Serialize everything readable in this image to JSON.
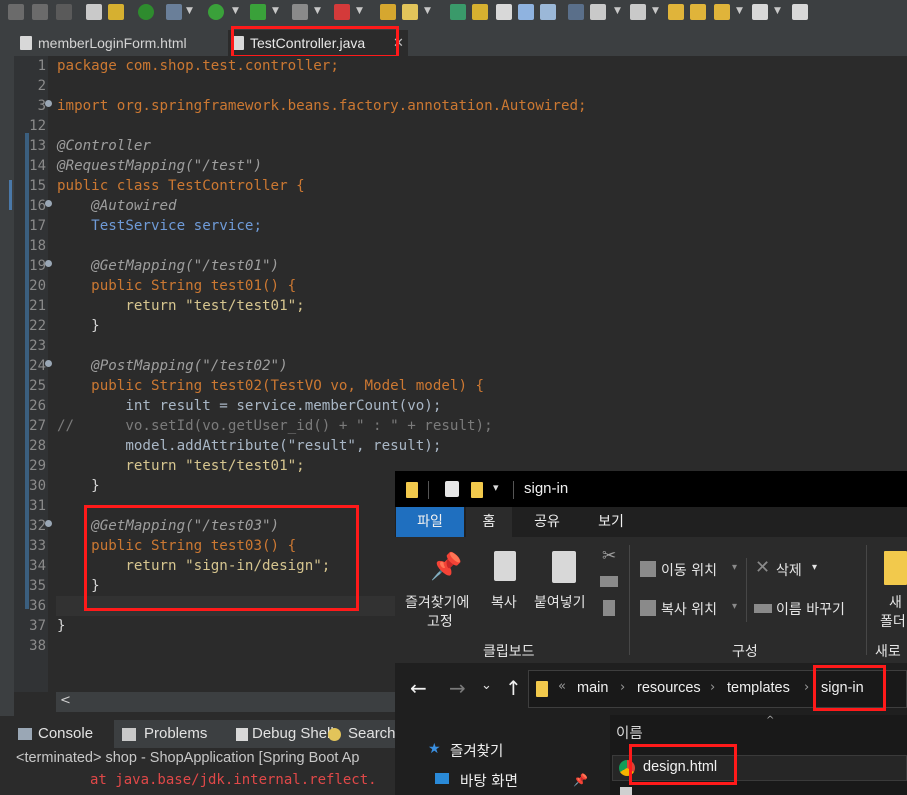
{
  "editor": {
    "tabs": [
      {
        "label": "memberLoginForm.html",
        "active": false
      },
      {
        "label": "TestController.java",
        "active": true
      }
    ],
    "lines": [
      {
        "num": "1",
        "code": "package com.shop.test.controller;"
      },
      {
        "num": "2",
        "code": ""
      },
      {
        "num": "3",
        "code": "import org.springframework.beans.factory.annotation.Autowired;"
      },
      {
        "num": "12",
        "code": ""
      },
      {
        "num": "13",
        "code": "@Controller"
      },
      {
        "num": "14",
        "code": "@RequestMapping(\"/test\")"
      },
      {
        "num": "15",
        "code": "public class TestController {"
      },
      {
        "num": "16",
        "code": "    @Autowired"
      },
      {
        "num": "17",
        "code": "    TestService service;"
      },
      {
        "num": "18",
        "code": ""
      },
      {
        "num": "19",
        "code": "    @GetMapping(\"/test01\")"
      },
      {
        "num": "20",
        "code": "    public String test01() {"
      },
      {
        "num": "21",
        "code": "        return \"test/test01\";"
      },
      {
        "num": "22",
        "code": "    }"
      },
      {
        "num": "23",
        "code": ""
      },
      {
        "num": "24",
        "code": "    @PostMapping(\"/test02\")"
      },
      {
        "num": "25",
        "code": "    public String test02(TestVO vo, Model model) {"
      },
      {
        "num": "26",
        "code": "        int result = service.memberCount(vo);"
      },
      {
        "num": "27",
        "code": "//      vo.setId(vo.getUser_id() + \" : \" + result);"
      },
      {
        "num": "28",
        "code": "        model.addAttribute(\"result\", result);"
      },
      {
        "num": "29",
        "code": "        return \"test/test01\";"
      },
      {
        "num": "30",
        "code": "    }"
      },
      {
        "num": "31",
        "code": ""
      },
      {
        "num": "32",
        "code": "    @GetMapping(\"/test03\")"
      },
      {
        "num": "33",
        "code": "    public String test03() {"
      },
      {
        "num": "34",
        "code": "        return \"sign-in/design\";"
      },
      {
        "num": "35",
        "code": "    }"
      },
      {
        "num": "36",
        "code": ""
      },
      {
        "num": "37",
        "code": "}"
      },
      {
        "num": "38",
        "code": ""
      }
    ]
  },
  "console": {
    "tabs": [
      "Console",
      "Problems",
      "Debug Shell",
      "Search"
    ],
    "status": "<terminated> shop - ShopApplication [Spring Boot Ap",
    "error_line": "at java.base/jdk.internal.reflect."
  },
  "explorer": {
    "title": "sign-in",
    "ribbon_tabs": [
      "파일",
      "홈",
      "공유",
      "보기"
    ],
    "clipboard": {
      "pin_label_1": "즐겨찾기에",
      "pin_label_2": "고정",
      "copy": "복사",
      "paste": "붙여넣기",
      "group": "클립보드"
    },
    "organize": {
      "move_to": "이동 위치",
      "copy_to": "복사 위치",
      "delete": "삭제",
      "rename": "이름 바꾸기",
      "group": "구성"
    },
    "new": {
      "folder_1": "새",
      "folder_2": "폴더",
      "group": "새로"
    },
    "address": {
      "prefix": "«",
      "crumbs": [
        "main",
        "resources",
        "templates",
        "sign-in"
      ]
    },
    "column_header": "이름",
    "nav": {
      "favorites": "즐겨찾기",
      "desktop": "바탕 화면"
    },
    "files": [
      "design.html"
    ]
  },
  "colors": {
    "highlight_box": "#ff1a1a",
    "explorer_selected_tab": "#1f6fbf"
  }
}
